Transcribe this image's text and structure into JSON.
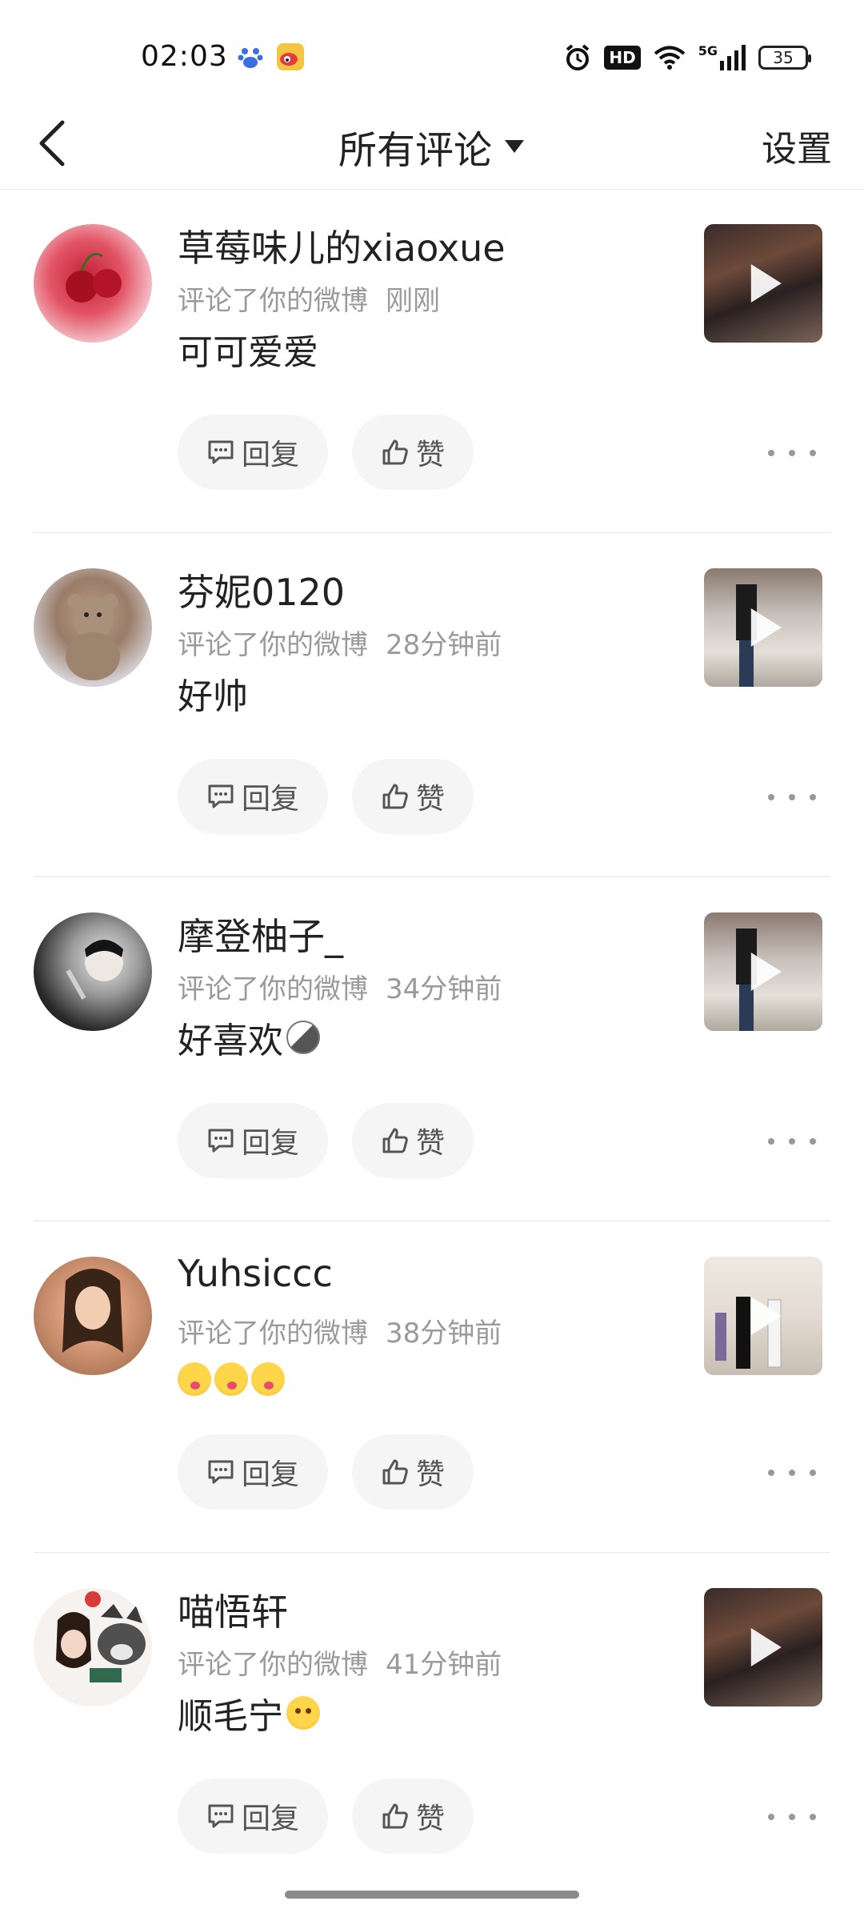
{
  "status_bar": {
    "time": "02:03",
    "icons": [
      "baidu-icon",
      "weibo-icon",
      "alarm-icon",
      "hd-icon",
      "wifi-icon",
      "5g-signal-icon",
      "battery-icon"
    ],
    "hd_label": "HD",
    "network_label": "5G",
    "battery": "35"
  },
  "nav": {
    "back_icon": "chevron-left-icon",
    "title": "所有评论",
    "title_dropdown_icon": "triangle-down-icon",
    "settings_label": "设置"
  },
  "actions": {
    "reply_label": "回复",
    "like_label": "赞",
    "reply_icon": "comment-icon",
    "like_icon": "thumbs-up-icon",
    "more_icon": "more-dots-icon"
  },
  "comments": [
    {
      "username": "草莓味儿的xiaoxue",
      "action": "评论了你的微博",
      "time": "刚刚",
      "text": "可可爱爱",
      "emojis": []
    },
    {
      "username": "芬妮0120",
      "action": "评论了你的微博",
      "time": "28分钟前",
      "text": "好帅",
      "emojis": []
    },
    {
      "username": "摩登柚子_",
      "action": "评论了你的微博",
      "time": "34分钟前",
      "text": "好喜欢",
      "emojis": [
        "cat-emoji"
      ]
    },
    {
      "username": "Yuhsiccc",
      "action": "评论了你的微博",
      "time": "38分钟前",
      "text": "",
      "emojis": [
        "kiss-emoji",
        "kiss-emoji",
        "kiss-emoji"
      ]
    },
    {
      "username": "喵悟轩",
      "action": "评论了你的微博",
      "time": "41分钟前",
      "text": "顺毛宁",
      "emojis": [
        "love-emoji"
      ]
    }
  ],
  "colors": {
    "text_primary": "#222222",
    "text_secondary": "#9a9a9a",
    "pill_bg": "#f5f5f5",
    "divider": "#e8e8e8"
  }
}
